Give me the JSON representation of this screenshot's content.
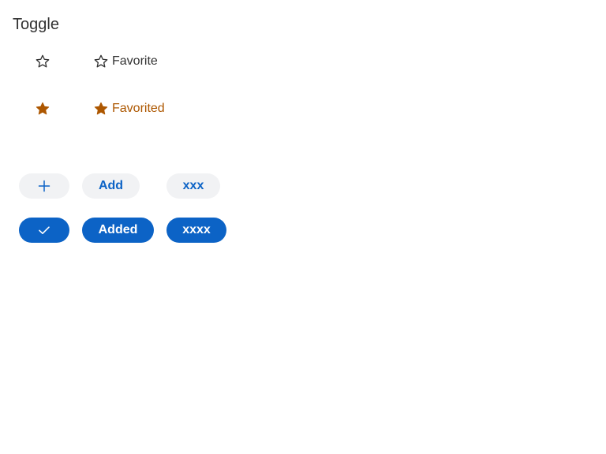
{
  "title": "Toggle",
  "favorite_toggles": {
    "off_icon": "star-outline-icon",
    "off_label": "Favorite",
    "on_icon": "star-filled-icon",
    "on_label": "Favorited",
    "off_color": "#333333",
    "on_color": "#ad5700"
  },
  "chip_toggles": {
    "off": {
      "icon": "plus-icon",
      "label": "Add",
      "custom_label": "xxx"
    },
    "on": {
      "icon": "check-icon",
      "label": "Added",
      "custom_label": "xxxx"
    },
    "accent": "#0c63c6",
    "off_background": "#f1f2f4"
  }
}
